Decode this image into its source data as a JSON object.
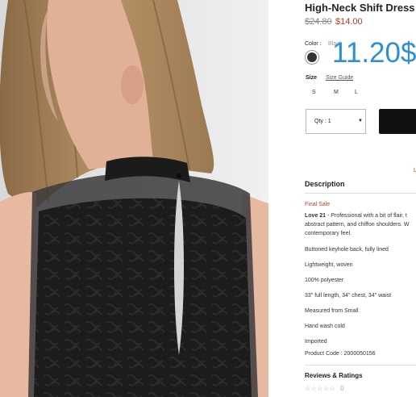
{
  "product": {
    "title": "High-Neck Shift Dress",
    "old_price": "$24.80",
    "new_price": "$14.00",
    "overlay_price": "11.20$"
  },
  "color": {
    "label": "Color :",
    "value": "Black",
    "swatch_color": "#333333"
  },
  "size": {
    "label": "Size",
    "guide": "Size Guide",
    "options": [
      "S",
      "M",
      "L"
    ]
  },
  "qty": {
    "label": "Qty : 1"
  },
  "red_fragment": "L",
  "description": {
    "heading": "Description",
    "final_sale": "Final Sale",
    "brand": "Love 21",
    "line1": " - Professional with a bit of flair, t",
    "line2": "abstract pattern, and chiffon shoulders. W",
    "line3": "contemporary feel.",
    "bullets": [
      "Buttoned keyhole back, fully lined",
      "Lightweight, woven",
      "100% polyester",
      "33\" full length, 34\" chest, 34\" waist",
      "Measured from Small",
      "Hand wash cold",
      "Imported",
      "Product Code : 2000050156"
    ]
  },
  "reviews": {
    "heading": "Reviews & Ratings",
    "stars": "☆☆☆☆☆",
    "count": "0"
  }
}
